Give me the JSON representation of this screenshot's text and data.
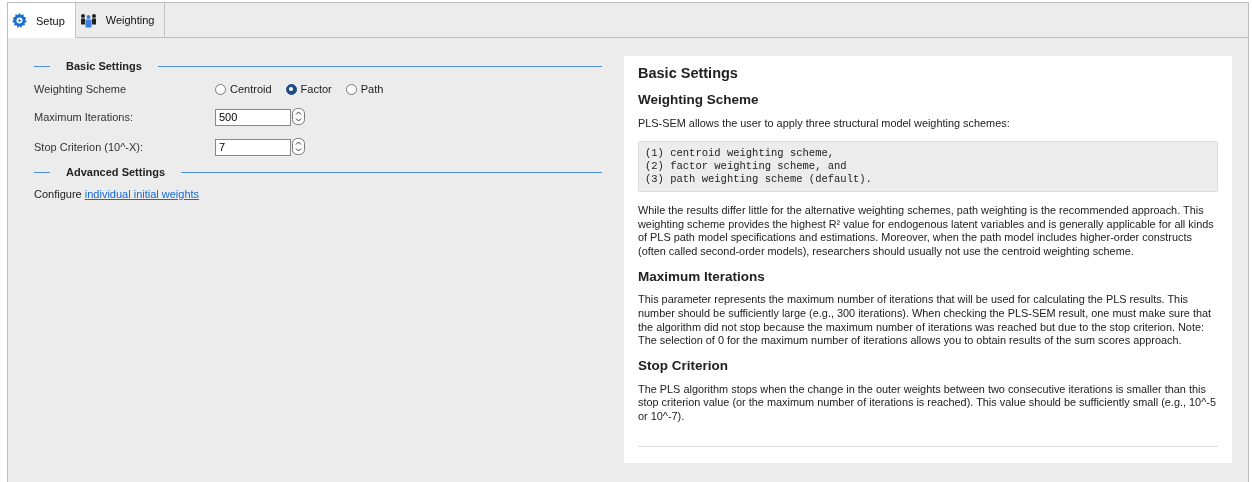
{
  "tabs": [
    {
      "label": "Setup",
      "selected": true
    },
    {
      "label": "Weighting",
      "selected": false
    }
  ],
  "settings": {
    "basic_title": "Basic Settings",
    "weighting_scheme": {
      "label": "Weighting Scheme",
      "options": [
        {
          "label": "Centroid",
          "selected": false
        },
        {
          "label": "Factor",
          "selected": true
        },
        {
          "label": "Path",
          "selected": false
        }
      ]
    },
    "maximum_iterations": {
      "label": "Maximum Iterations:",
      "value": "500"
    },
    "stop_criterion": {
      "label": "Stop Criterion (10^-X):",
      "value": "7"
    },
    "advanced_title": "Advanced Settings",
    "configure": {
      "text": "Configure",
      "link": "individual initial weights"
    }
  },
  "help": {
    "title": "Basic Settings",
    "sections": [
      {
        "heading": "Weighting Scheme",
        "blocks": [
          {
            "kind": "paragraph",
            "text": "PLS-SEM allows the user to apply three structural model weighting schemes:"
          },
          {
            "kind": "code",
            "lines": [
              "(1) centroid weighting scheme,",
              "(2) factor weighting scheme, and",
              "(3) path weighting scheme (default)."
            ]
          },
          {
            "kind": "paragraph",
            "text": "While the results differ little for the alternative weighting schemes, path weighting is the recommended approach. This weighting scheme provides the highest R² value for endogenous latent variables and is generally applicable for all kinds of PLS path model specifications and estimations. Moreover, when the path model includes higher-order constructs (often called second-order models), researchers should usually not use the centroid weighting scheme."
          }
        ]
      },
      {
        "heading": "Maximum Iterations",
        "blocks": [
          {
            "kind": "paragraph",
            "text": "This parameter represents the maximum number of iterations that will be used for calculating the PLS results. This number should be sufficiently large (e.g., 300 iterations). When checking the PLS-SEM result, one must make sure that the algorithm did not stop because the maximum number of iterations was reached but due to the stop criterion. Note: The selection of 0 for the maximum number of iterations allows you to obtain results of the sum scores approach."
          }
        ]
      },
      {
        "heading": "Stop Criterion",
        "blocks": [
          {
            "kind": "paragraph",
            "text": "The PLS algorithm stops when the change in the outer weights between two consecutive iterations is smaller than this stop criterion value (or the maximum number of iterations is reached). This value should be sufficiently small (e.g., 10^-5 or 10^-7)."
          }
        ]
      }
    ]
  }
}
